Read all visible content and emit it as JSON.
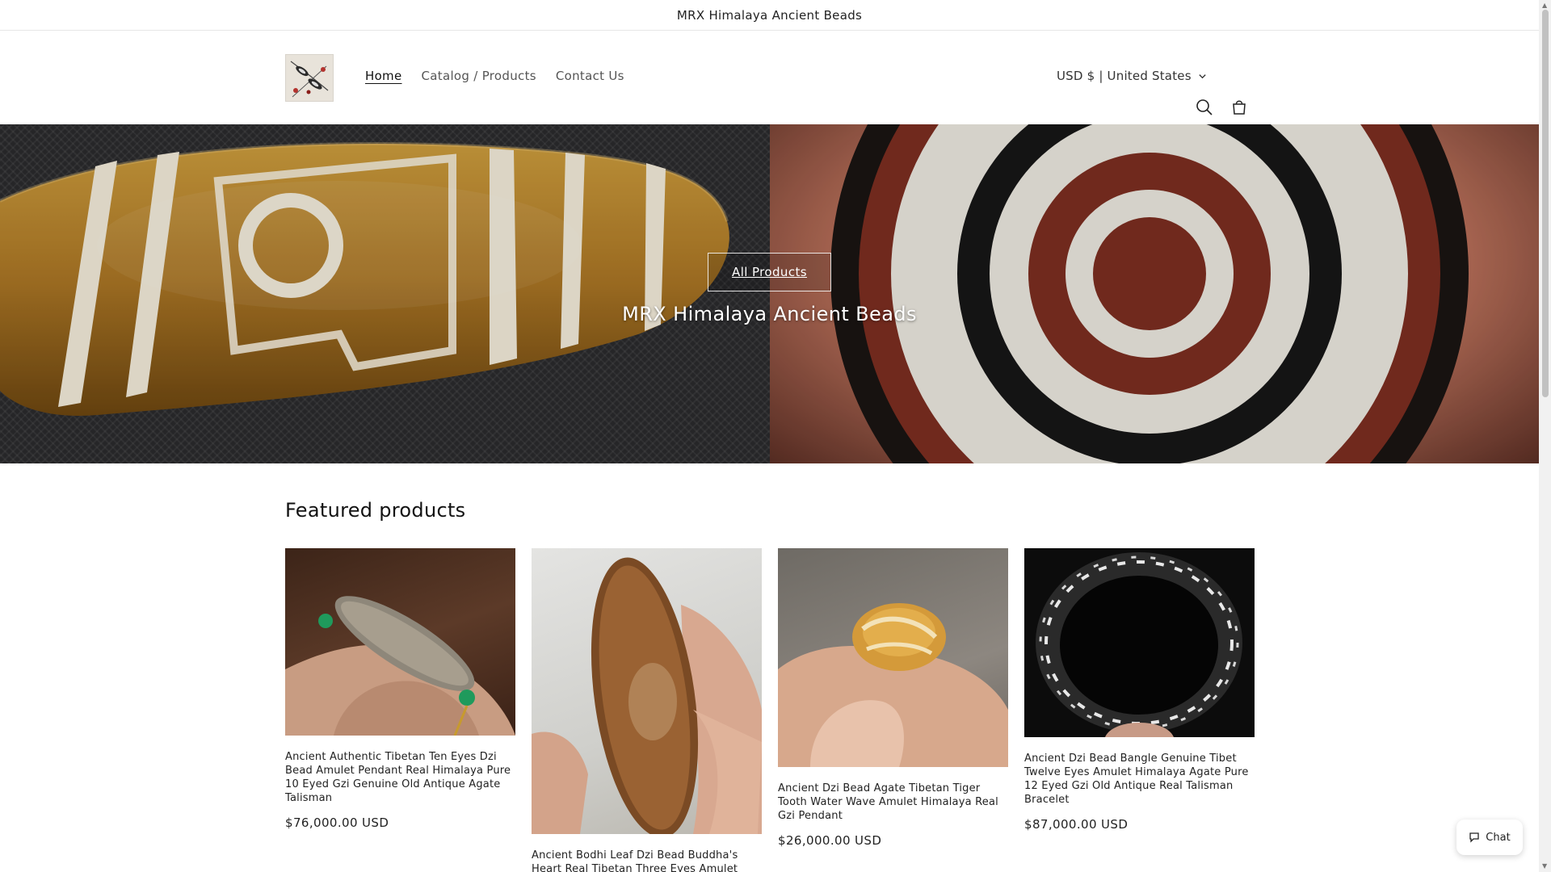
{
  "announcement": {
    "text": "MRX Himalaya Ancient Beads"
  },
  "header": {
    "nav": [
      {
        "label": "Home",
        "active": true
      },
      {
        "label": "Catalog / Products",
        "active": false
      },
      {
        "label": "Contact Us",
        "active": false
      }
    ],
    "currency_label": "USD $ | United States",
    "icons": [
      "logo-image",
      "chevron-down-icon",
      "search-icon",
      "cart-icon"
    ]
  },
  "hero": {
    "button_label": "All Products",
    "title": "MRX Himalaya Ancient Beads"
  },
  "featured": {
    "title": "Featured products",
    "products": [
      {
        "name": "Ancient Authentic Tibetan Ten Eyes Dzi Bead Amulet Pendant Real Himalaya Pure 10 Eyed Gzi Genuine Old Antique Agate Talisman",
        "price": "$76,000.00 USD"
      },
      {
        "name": "Ancient Bodhi Leaf Dzi Bead Buddha's Heart Real Tibetan Three Eyes Amulet Pendant",
        "price": ""
      },
      {
        "name": "Ancient Dzi Bead Agate Tibetan Tiger Tooth Water Wave Amulet Himalaya Real Gzi Pendant",
        "price": "$26,000.00 USD"
      },
      {
        "name": "Ancient Dzi Bead Bangle Genuine Tibet Twelve Eyes Amulet Himalaya Agate Pure 12 Eyed Gzi Old Antique Real Talisman Bracelet",
        "price": "$87,000.00 USD"
      }
    ]
  },
  "chat": {
    "label": "Chat"
  },
  "colors": {
    "accent": "#121212",
    "background": "#ffffff",
    "muted_text": "#555555"
  }
}
